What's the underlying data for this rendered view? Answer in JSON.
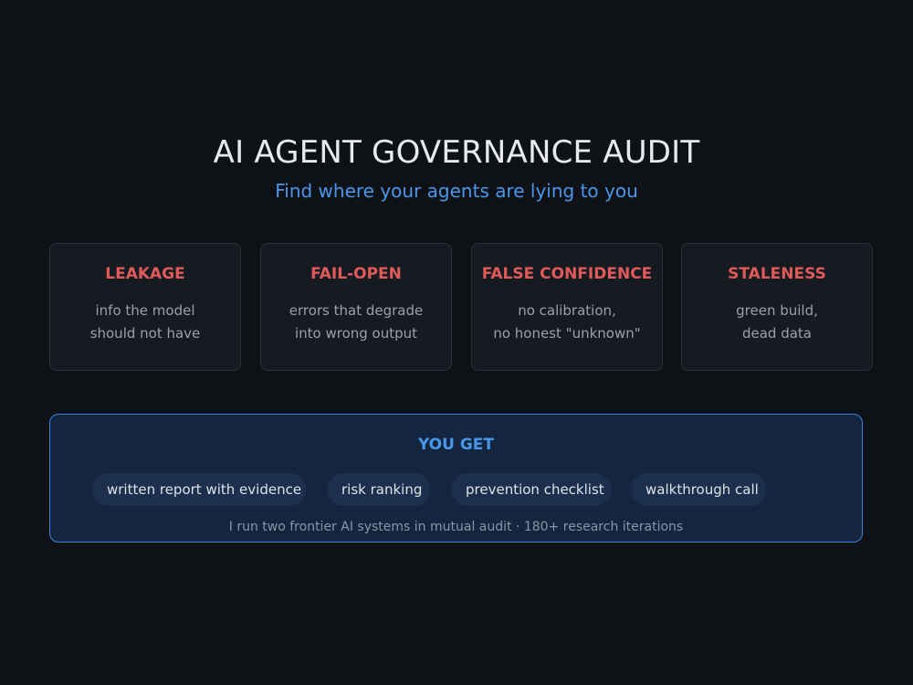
{
  "header": {
    "title": "AI AGENT GOVERNANCE AUDIT",
    "subtitle": "Find where your agents are lying to you"
  },
  "cards": [
    {
      "title": "LEAKAGE",
      "lines": [
        "info the model",
        "should not have"
      ]
    },
    {
      "title": "FAIL-OPEN",
      "lines": [
        "errors that degrade",
        "into wrong output"
      ]
    },
    {
      "title": "FALSE CONFIDENCE",
      "lines": [
        "no calibration,",
        "no honest \"unknown\""
      ]
    },
    {
      "title": "STALENESS",
      "lines": [
        "green build,",
        "dead data"
      ]
    }
  ],
  "you_get": {
    "title": "YOU GET",
    "items": [
      "written report with evidence",
      "risk ranking",
      "prevention checklist",
      "walkthrough call"
    ],
    "footnote": "I run two frontier AI systems in mutual audit · 180+ research iterations"
  },
  "colors": {
    "background": "#0e1116",
    "accent_blue": "#4a97ea",
    "risk_red": "#e05a5a"
  }
}
